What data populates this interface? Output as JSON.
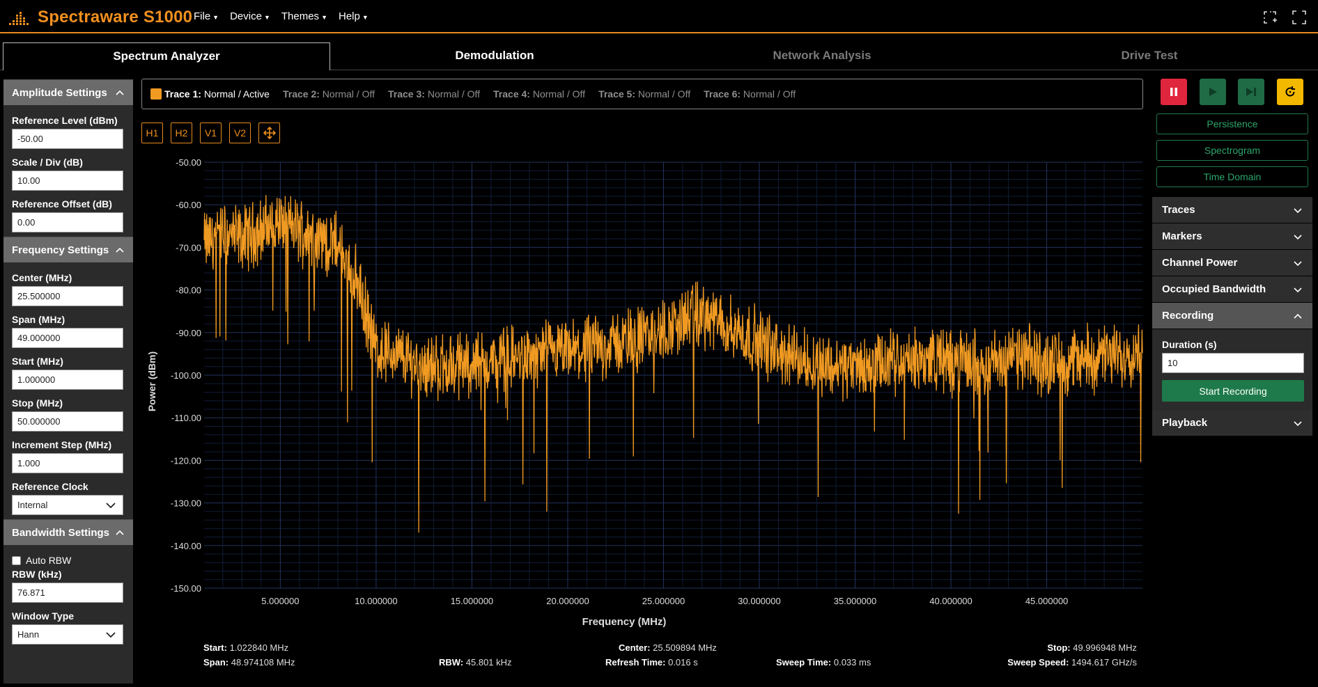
{
  "app": {
    "title": "Spectraware S1000"
  },
  "menu": [
    {
      "label": "File"
    },
    {
      "label": "Device"
    },
    {
      "label": "Themes"
    },
    {
      "label": "Help"
    }
  ],
  "tabs": [
    {
      "label": "Spectrum Analyzer",
      "active": true
    },
    {
      "label": "Demodulation",
      "active": false
    },
    {
      "label": "Network Analysis",
      "active": false
    },
    {
      "label": "Drive Test",
      "active": false
    }
  ],
  "amplitude": {
    "title": "Amplitude Settings",
    "ref_level_label": "Reference Level (dBm)",
    "ref_level": "-50.00",
    "scale_label": "Scale / Div (dB)",
    "scale": "10.00",
    "offset_label": "Reference Offset (dB)",
    "offset": "0.00"
  },
  "frequency": {
    "title": "Frequency Settings",
    "center_label": "Center (MHz)",
    "center": "25.500000",
    "span_label": "Span (MHz)",
    "span": "49.000000",
    "start_label": "Start (MHz)",
    "start": "1.000000",
    "stop_label": "Stop (MHz)",
    "stop": "50.000000",
    "step_label": "Increment Step (MHz)",
    "step": "1.000",
    "clock_label": "Reference Clock",
    "clock": "Internal"
  },
  "bandwidth": {
    "title": "Bandwidth Settings",
    "auto_rbw_label": "Auto RBW",
    "auto_rbw": false,
    "rbw_label": "RBW (kHz)",
    "rbw": "76.871",
    "window_label": "Window Type",
    "window": "Hann"
  },
  "traces": [
    {
      "name": "Trace 1:",
      "mode": "Normal / Active",
      "active": true
    },
    {
      "name": "Trace 2:",
      "mode": "Normal / Off",
      "active": false
    },
    {
      "name": "Trace 3:",
      "mode": "Normal / Off",
      "active": false
    },
    {
      "name": "Trace 4:",
      "mode": "Normal / Off",
      "active": false
    },
    {
      "name": "Trace 5:",
      "mode": "Normal / Off",
      "active": false
    },
    {
      "name": "Trace 6:",
      "mode": "Normal / Off",
      "active": false
    }
  ],
  "tools": [
    "H1",
    "H2",
    "V1",
    "V2"
  ],
  "colors": {
    "accent": "#f0901f",
    "trace": "#f09a22",
    "grid": "#1c2a4a",
    "pause": "#e0263d",
    "play": "#1f7a4d",
    "reset": "#f3b800"
  },
  "chart_data": {
    "type": "line",
    "xlabel": "Frequency (MHz)",
    "ylabel": "Power (dBm)",
    "xlim": [
      1.02284,
      49.996948
    ],
    "ylim": [
      -150,
      -50
    ],
    "x_ticks": [
      "5.000000",
      "10.000000",
      "15.000000",
      "20.000000",
      "25.000000",
      "30.000000",
      "35.000000",
      "40.000000",
      "45.000000"
    ],
    "y_ticks": [
      "-50.00",
      "-60.00",
      "-70.00",
      "-80.00",
      "-90.00",
      "-100.00",
      "-110.00",
      "-120.00",
      "-130.00",
      "-140.00",
      "-150.00"
    ],
    "grid": true,
    "series": [
      {
        "name": "Trace 1",
        "x": [
          1.0,
          2.0,
          3.0,
          4.0,
          5.0,
          6.0,
          7.0,
          8.0,
          9.0,
          10.0,
          11.0,
          12.0,
          13.0,
          14.0,
          15.0,
          16.0,
          17.0,
          18.0,
          19.0,
          20.0,
          21.0,
          22.0,
          23.0,
          24.0,
          25.0,
          26.0,
          27.0,
          28.0,
          29.0,
          30.0,
          31.0,
          32.0,
          33.0,
          34.0,
          35.0,
          36.0,
          37.0,
          38.0,
          39.0,
          40.0,
          41.0,
          42.0,
          43.0,
          44.0,
          45.0,
          46.0,
          47.0,
          48.0,
          49.0,
          50.0
        ],
        "values": [
          -69,
          -67,
          -68,
          -66,
          -64,
          -66,
          -68,
          -70,
          -78,
          -94,
          -95,
          -97,
          -98,
          -98,
          -97,
          -97,
          -96,
          -96,
          -95,
          -95,
          -94,
          -93,
          -92,
          -91,
          -90,
          -87,
          -86,
          -88,
          -90,
          -92,
          -95,
          -96,
          -97,
          -98,
          -98,
          -98,
          -97,
          -97,
          -96,
          -97,
          -97,
          -97,
          -96,
          -96,
          -97,
          -97,
          -96,
          -96,
          -95,
          -94
        ]
      }
    ]
  },
  "status": {
    "start_label": "Start:",
    "start": "1.022840 MHz",
    "span_label": "Span:",
    "span": "48.974108 MHz",
    "rbw_label": "RBW:",
    "rbw": "45.801 kHz",
    "center_label": "Center:",
    "center": "25.509894 MHz",
    "refresh_label": "Refresh Time:",
    "refresh": "0.016 s",
    "sweep_time_label": "Sweep Time:",
    "sweep_time": "0.033 ms",
    "stop_label": "Stop:",
    "stop": "49.996948 MHz",
    "sweep_speed_label": "Sweep Speed:",
    "sweep_speed": "1494.617 GHz/s"
  },
  "views": [
    {
      "label": "Persistence"
    },
    {
      "label": "Spectrogram"
    },
    {
      "label": "Time Domain"
    }
  ],
  "panels": {
    "traces": "Traces",
    "markers": "Markers",
    "channel_power": "Channel Power",
    "occupied_bw": "Occupied Bandwidth",
    "recording": "Recording",
    "duration_label": "Duration (s)",
    "duration": "10",
    "start_recording": "Start Recording",
    "playback": "Playback"
  }
}
